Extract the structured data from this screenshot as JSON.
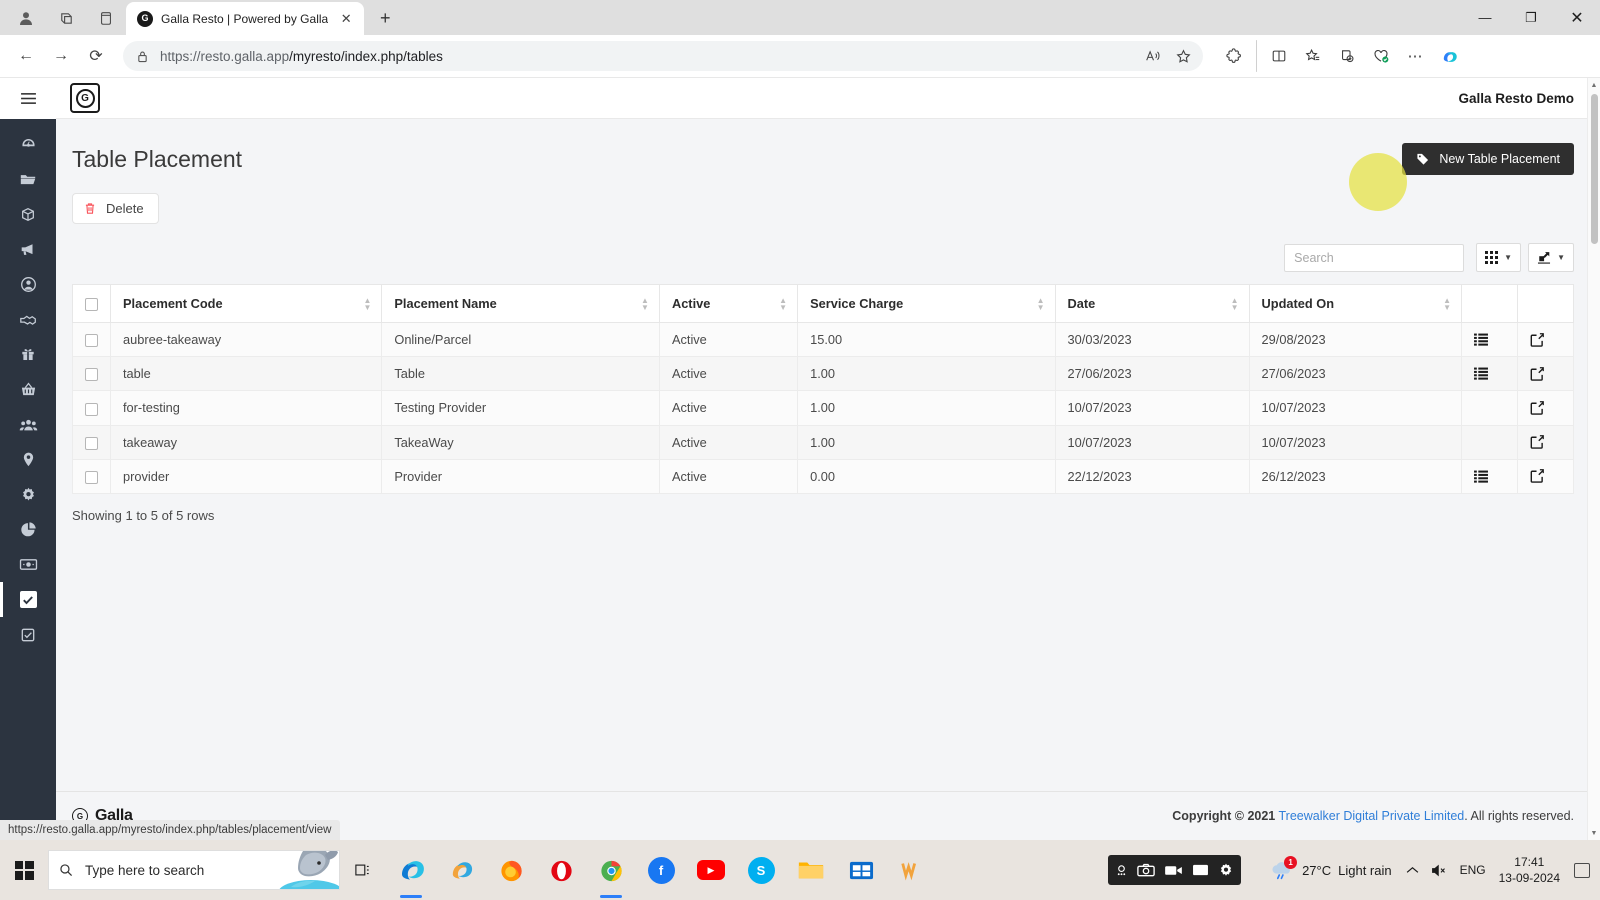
{
  "browser": {
    "tab": {
      "title": "Galla Resto | Powered by Galla",
      "favicon_letter": "G",
      "close_label": "✕"
    },
    "new_tab_label": "+",
    "window_controls": {
      "minimize": "—",
      "maximize": "❐",
      "close": "✕"
    },
    "nav": {
      "back": "←",
      "forward": "→",
      "reload": "⟳"
    },
    "url": {
      "scheme_host": "https://resto.galla.app",
      "path": "/myresto/index.php/tables",
      "lock_icon": "lock-icon"
    },
    "status_url": "https://resto.galla.app/myresto/index.php/tables/placement/view"
  },
  "sidebar": {
    "menu_toggle": "☰",
    "items": [
      {
        "name": "dashboard",
        "icon": "gauge-icon",
        "glyph": "◴"
      },
      {
        "name": "files",
        "icon": "folder-icon",
        "glyph": "▰"
      },
      {
        "name": "products",
        "icon": "box-icon",
        "glyph": "▣"
      },
      {
        "name": "marketing",
        "icon": "megaphone-icon",
        "glyph": "◤"
      },
      {
        "name": "account",
        "icon": "user-circle-icon",
        "glyph": "◉"
      },
      {
        "name": "partners",
        "icon": "handshake-icon",
        "glyph": "◎"
      },
      {
        "name": "offers",
        "icon": "gift-icon",
        "glyph": "▤"
      },
      {
        "name": "orders",
        "icon": "basket-icon",
        "glyph": "▥"
      },
      {
        "name": "customers",
        "icon": "users-icon",
        "glyph": "▦"
      },
      {
        "name": "locations",
        "icon": "map-pin-icon",
        "glyph": "◈"
      },
      {
        "name": "settings",
        "icon": "gear-icon",
        "glyph": "✺"
      },
      {
        "name": "reports",
        "icon": "pie-chart-icon",
        "glyph": "◕"
      },
      {
        "name": "payments",
        "icon": "money-icon",
        "glyph": "▭"
      },
      {
        "name": "tables",
        "icon": "checkbox-icon",
        "glyph": "✔",
        "active": true
      },
      {
        "name": "tasks",
        "icon": "checkbox-icon",
        "glyph": "✔"
      }
    ]
  },
  "topbar": {
    "user_label": "Galla Resto Demo",
    "logo_letter": "G"
  },
  "page": {
    "title": "Table Placement",
    "new_button": {
      "label": "New Table Placement",
      "icon": "tag-icon"
    },
    "delete_button": {
      "label": "Delete",
      "icon": "trash-icon"
    },
    "search": {
      "placeholder": "Search",
      "value": ""
    },
    "columns_button": {
      "icon": "grid-icon",
      "caret": "▼"
    },
    "export_button": {
      "icon": "export-icon",
      "caret": "▼"
    },
    "rows_info": "Showing 1 to 5 of 5 rows"
  },
  "table": {
    "columns": [
      {
        "label": "",
        "key": "checkbox"
      },
      {
        "label": "Placement Code",
        "key": "code",
        "sortable": true
      },
      {
        "label": "Placement Name",
        "key": "name",
        "sortable": true
      },
      {
        "label": "Active",
        "key": "active",
        "sortable": true
      },
      {
        "label": "Service Charge",
        "key": "charge",
        "sortable": true
      },
      {
        "label": "Date",
        "key": "date",
        "sortable": true
      },
      {
        "label": "Updated On",
        "key": "updated",
        "sortable": true
      },
      {
        "label": "",
        "key": "list_action"
      },
      {
        "label": "",
        "key": "edit_action"
      }
    ],
    "rows": [
      {
        "code": "aubree-takeaway",
        "name": "Online/Parcel",
        "active": "Active",
        "charge": "15.00",
        "date": "30/03/2023",
        "updated": "29/08/2023",
        "has_list": true
      },
      {
        "code": "table",
        "name": "Table",
        "active": "Active",
        "charge": "1.00",
        "date": "27/06/2023",
        "updated": "27/06/2023",
        "has_list": true
      },
      {
        "code": "for-testing",
        "name": "Testing Provider",
        "active": "Active",
        "charge": "1.00",
        "date": "10/07/2023",
        "updated": "10/07/2023",
        "has_list": false
      },
      {
        "code": "takeaway",
        "name": "TakeaWay",
        "active": "Active",
        "charge": "1.00",
        "date": "10/07/2023",
        "updated": "10/07/2023",
        "has_list": false
      },
      {
        "code": "provider",
        "name": "Provider",
        "active": "Active",
        "charge": "0.00",
        "date": "22/12/2023",
        "updated": "26/12/2023",
        "has_list": true
      }
    ]
  },
  "footer": {
    "brand": "Galla",
    "copyright_prefix": "Copyright © 2021",
    "company_link": "Treewalker Digital Private Limited",
    "copyright_suffix": ". All rights reserved."
  },
  "taskbar": {
    "search_placeholder": "Type here to search",
    "weather": {
      "temp": "27°C",
      "condition": "Light rain",
      "badge": "1"
    },
    "language": "ENG",
    "time": "17:41",
    "date": "13-09-2024",
    "apps": [
      {
        "name": "edge",
        "letter": "e"
      },
      {
        "name": "copilot",
        "letter": ""
      },
      {
        "name": "firefox",
        "letter": ""
      },
      {
        "name": "opera",
        "letter": "O"
      },
      {
        "name": "chrome",
        "letter": ""
      },
      {
        "name": "facebook",
        "letter": "f"
      },
      {
        "name": "youtube",
        "letter": "▶"
      },
      {
        "name": "skype",
        "letter": "S"
      },
      {
        "name": "file-explorer",
        "letter": ""
      },
      {
        "name": "store",
        "letter": ""
      },
      {
        "name": "app-extra",
        "letter": "W"
      }
    ]
  },
  "colors": {
    "sidebar_bg": "#2c3440",
    "accent_dark": "#2f2f2f",
    "delete_red": "#f9545b",
    "link_blue": "#2f7ed8",
    "highlight": "#e4e240"
  }
}
